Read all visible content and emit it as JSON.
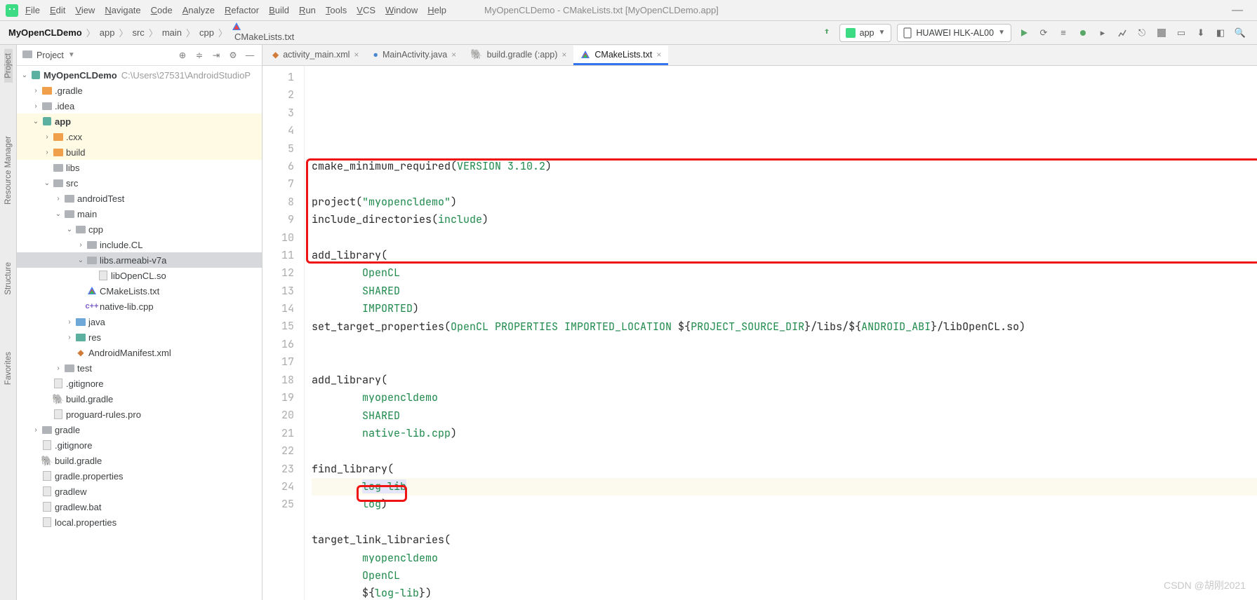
{
  "window_title": "MyOpenCLDemo - CMakeLists.txt [MyOpenCLDemo.app]",
  "menus": [
    "File",
    "Edit",
    "View",
    "Navigate",
    "Code",
    "Analyze",
    "Refactor",
    "Build",
    "Run",
    "Tools",
    "VCS",
    "Window",
    "Help"
  ],
  "breadcrumb": [
    "MyOpenCLDemo",
    "app",
    "src",
    "main",
    "cpp",
    "CMakeLists.txt"
  ],
  "run_config": "app",
  "device": "HUAWEI HLK-AL00",
  "project_panel": {
    "title": "Project"
  },
  "tree": [
    {
      "ind": 0,
      "tw": "v",
      "icon": "mod",
      "label": "MyOpenCLDemo",
      "path": "C:\\Users\\27531\\AndroidStudioP",
      "bold": true
    },
    {
      "ind": 1,
      "tw": ">",
      "icon": "fold-orange",
      "label": ".gradle"
    },
    {
      "ind": 1,
      "tw": ">",
      "icon": "fold-grey",
      "label": ".idea"
    },
    {
      "ind": 1,
      "tw": "v",
      "icon": "mod",
      "label": "app",
      "bold": true,
      "hl": true
    },
    {
      "ind": 2,
      "tw": ">",
      "icon": "fold-orange",
      "label": ".cxx",
      "hl": true
    },
    {
      "ind": 2,
      "tw": ">",
      "icon": "fold-orange",
      "label": "build",
      "hl": true
    },
    {
      "ind": 2,
      "tw": "",
      "icon": "fold-grey",
      "label": "libs"
    },
    {
      "ind": 2,
      "tw": "v",
      "icon": "fold-grey",
      "label": "src"
    },
    {
      "ind": 3,
      "tw": ">",
      "icon": "fold-grey",
      "label": "androidTest"
    },
    {
      "ind": 3,
      "tw": "v",
      "icon": "fold-grey",
      "label": "main"
    },
    {
      "ind": 4,
      "tw": "v",
      "icon": "fold-grey",
      "label": "cpp"
    },
    {
      "ind": 5,
      "tw": ">",
      "icon": "fold-grey",
      "label": "include.CL"
    },
    {
      "ind": 5,
      "tw": "v",
      "icon": "fold-grey",
      "label": "libs.armeabi-v7a",
      "sel": true
    },
    {
      "ind": 6,
      "tw": "",
      "icon": "file",
      "label": "libOpenCL.so"
    },
    {
      "ind": 5,
      "tw": "",
      "icon": "cmake",
      "label": "CMakeLists.txt"
    },
    {
      "ind": 5,
      "tw": "",
      "icon": "cpp",
      "label": "native-lib.cpp"
    },
    {
      "ind": 4,
      "tw": ">",
      "icon": "fold-blue",
      "label": "java"
    },
    {
      "ind": 4,
      "tw": ">",
      "icon": "fold-teal",
      "label": "res"
    },
    {
      "ind": 4,
      "tw": "",
      "icon": "xml",
      "label": "AndroidManifest.xml"
    },
    {
      "ind": 3,
      "tw": ">",
      "icon": "fold-grey",
      "label": "test"
    },
    {
      "ind": 2,
      "tw": "",
      "icon": "file",
      "label": ".gitignore"
    },
    {
      "ind": 2,
      "tw": "",
      "icon": "gradle",
      "label": "build.gradle"
    },
    {
      "ind": 2,
      "tw": "",
      "icon": "file",
      "label": "proguard-rules.pro"
    },
    {
      "ind": 1,
      "tw": ">",
      "icon": "fold-grey",
      "label": "gradle"
    },
    {
      "ind": 1,
      "tw": "",
      "icon": "file",
      "label": ".gitignore"
    },
    {
      "ind": 1,
      "tw": "",
      "icon": "gradle",
      "label": "build.gradle"
    },
    {
      "ind": 1,
      "tw": "",
      "icon": "file",
      "label": "gradle.properties"
    },
    {
      "ind": 1,
      "tw": "",
      "icon": "file",
      "label": "gradlew"
    },
    {
      "ind": 1,
      "tw": "",
      "icon": "file",
      "label": "gradlew.bat"
    },
    {
      "ind": 1,
      "tw": "",
      "icon": "file",
      "label": "local.properties"
    }
  ],
  "tabs": [
    {
      "label": "activity_main.xml",
      "icon": "xml"
    },
    {
      "label": "MainActivity.java",
      "icon": "java"
    },
    {
      "label": "build.gradle (:app)",
      "icon": "gradle"
    },
    {
      "label": "CMakeLists.txt",
      "icon": "cmake",
      "active": true
    }
  ],
  "left_strips": [
    "Project",
    "Resource Manager",
    "Structure",
    "Favorites"
  ],
  "code_lines": [
    [
      {
        "t": "cmake_minimum_required",
        "c": "fn"
      },
      {
        "t": "(",
        "c": "p"
      },
      {
        "t": "VERSION 3.10.2",
        "c": "arg"
      },
      {
        "t": ")",
        "c": "p"
      }
    ],
    [],
    [
      {
        "t": "project",
        "c": "fn"
      },
      {
        "t": "(",
        "c": "p"
      },
      {
        "t": "\"myopencldemo\"",
        "c": "arg"
      },
      {
        "t": ")",
        "c": "p"
      }
    ],
    [
      {
        "t": "include_directories",
        "c": "fn"
      },
      {
        "t": "(",
        "c": "p"
      },
      {
        "t": "include",
        "c": "arg"
      },
      {
        "t": ")",
        "c": "p"
      }
    ],
    [],
    [
      {
        "t": "add_library",
        "c": "fn"
      },
      {
        "t": "(",
        "c": "p"
      }
    ],
    [
      {
        "t": "        ",
        "c": "p"
      },
      {
        "t": "OpenCL",
        "c": "arg"
      }
    ],
    [
      {
        "t": "        ",
        "c": "p"
      },
      {
        "t": "SHARED",
        "c": "arg"
      }
    ],
    [
      {
        "t": "        ",
        "c": "p"
      },
      {
        "t": "IMPORTED",
        "c": "arg"
      },
      {
        "t": ")",
        "c": "p"
      }
    ],
    [
      {
        "t": "set_target_properties",
        "c": "fn"
      },
      {
        "t": "(",
        "c": "p"
      },
      {
        "t": "OpenCL PROPERTIES IMPORTED_LOCATION ",
        "c": "arg"
      },
      {
        "t": "${",
        "c": "p"
      },
      {
        "t": "PROJECT_SOURCE_DIR",
        "c": "arg"
      },
      {
        "t": "}",
        "c": "p"
      },
      {
        "t": "/libs/",
        "c": "path"
      },
      {
        "t": "${",
        "c": "p"
      },
      {
        "t": "ANDROID_ABI",
        "c": "arg"
      },
      {
        "t": "}",
        "c": "p"
      },
      {
        "t": "/libOpenCL.so",
        "c": "path"
      },
      {
        "t": ")",
        "c": "p"
      }
    ],
    [],
    [],
    [
      {
        "t": "add_library",
        "c": "fn"
      },
      {
        "t": "(",
        "c": "p"
      }
    ],
    [
      {
        "t": "        ",
        "c": "p"
      },
      {
        "t": "myopencldemo",
        "c": "arg"
      }
    ],
    [
      {
        "t": "        ",
        "c": "p"
      },
      {
        "t": "SHARED",
        "c": "arg"
      }
    ],
    [
      {
        "t": "        ",
        "c": "p"
      },
      {
        "t": "native-lib.cpp",
        "c": "arg"
      },
      {
        "t": ")",
        "c": "p"
      }
    ],
    [],
    [
      {
        "t": "find_library",
        "c": "fn"
      },
      {
        "t": "(",
        "c": "p"
      }
    ],
    [
      {
        "t": "        ",
        "c": "p"
      },
      {
        "t": "log-lib",
        "c": "arg",
        "sel": true
      }
    ],
    [
      {
        "t": "        ",
        "c": "p"
      },
      {
        "t": "log",
        "c": "arg"
      },
      {
        "t": ")",
        "c": "p"
      }
    ],
    [],
    [
      {
        "t": "target_link_libraries",
        "c": "fn"
      },
      {
        "t": "(",
        "c": "p"
      }
    ],
    [
      {
        "t": "        ",
        "c": "p"
      },
      {
        "t": "myopencldemo",
        "c": "arg"
      }
    ],
    [
      {
        "t": "        ",
        "c": "p"
      },
      {
        "t": "OpenCL",
        "c": "arg"
      }
    ],
    [
      {
        "t": "        ",
        "c": "p"
      },
      {
        "t": "${",
        "c": "p"
      },
      {
        "t": "log-lib",
        "c": "arg"
      },
      {
        "t": "}",
        "c": "p"
      },
      {
        "t": ")",
        "c": "p"
      }
    ]
  ],
  "watermark": "CSDN @胡刚2021"
}
